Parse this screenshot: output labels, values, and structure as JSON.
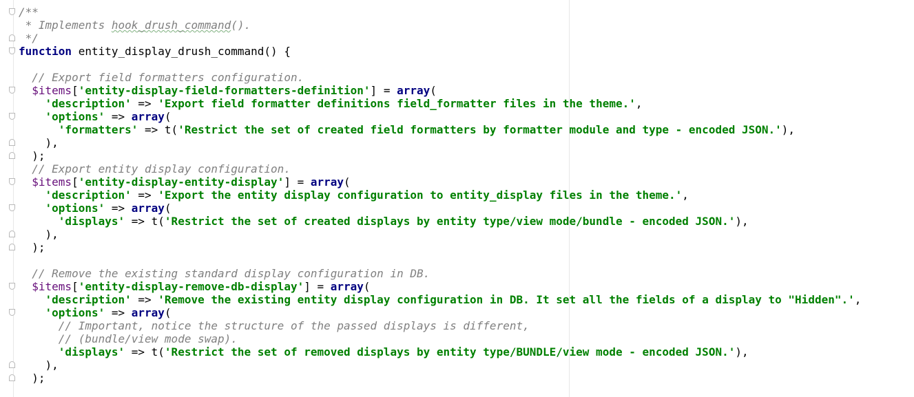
{
  "editor": {
    "language": "php",
    "lines": [
      {
        "fold": "open",
        "tokens": [
          {
            "c": "comment",
            "t": "/**"
          }
        ]
      },
      {
        "tokens": [
          {
            "c": "comment",
            "t": " * Implements "
          },
          {
            "c": "comment typo",
            "t": "hook_drush_command"
          },
          {
            "c": "comment",
            "t": "()."
          }
        ]
      },
      {
        "fold": "close",
        "tokens": [
          {
            "c": "comment",
            "t": " */"
          }
        ]
      },
      {
        "fold": "open",
        "tokens": [
          {
            "c": "kw",
            "t": "function"
          },
          {
            "c": "plain",
            "t": " entity_display_drush_command() {"
          }
        ]
      },
      {
        "tokens": []
      },
      {
        "tokens": [
          {
            "c": "comment",
            "t": "  // Export field formatters configuration."
          }
        ]
      },
      {
        "fold": "open",
        "tokens": [
          {
            "c": "var",
            "t": "  $items"
          },
          {
            "c": "plain",
            "t": "["
          },
          {
            "c": "str",
            "t": "'entity-display-field-formatters-definition'"
          },
          {
            "c": "plain",
            "t": "] = "
          },
          {
            "c": "kw",
            "t": "array"
          },
          {
            "c": "plain",
            "t": "("
          }
        ]
      },
      {
        "tokens": [
          {
            "c": "str",
            "t": "    'description'"
          },
          {
            "c": "plain",
            "t": " => "
          },
          {
            "c": "str",
            "t": "'Export field formatter definitions field_formatter files in the theme.'"
          },
          {
            "c": "plain",
            "t": ","
          }
        ]
      },
      {
        "fold": "open",
        "tokens": [
          {
            "c": "str",
            "t": "    'options'"
          },
          {
            "c": "plain",
            "t": " => "
          },
          {
            "c": "kw",
            "t": "array"
          },
          {
            "c": "plain",
            "t": "("
          }
        ]
      },
      {
        "tokens": [
          {
            "c": "str",
            "t": "      'formatters'"
          },
          {
            "c": "plain",
            "t": " => t("
          },
          {
            "c": "str",
            "t": "'Restrict the set of created field formatters by formatter module and type - encoded JSON.'"
          },
          {
            "c": "plain",
            "t": "),"
          }
        ]
      },
      {
        "fold": "close",
        "tokens": [
          {
            "c": "plain",
            "t": "    ),"
          }
        ]
      },
      {
        "fold": "close",
        "tokens": [
          {
            "c": "plain",
            "t": "  );"
          }
        ]
      },
      {
        "tokens": [
          {
            "c": "comment",
            "t": "  // Export entity display configuration."
          }
        ]
      },
      {
        "fold": "open",
        "tokens": [
          {
            "c": "var",
            "t": "  $items"
          },
          {
            "c": "plain",
            "t": "["
          },
          {
            "c": "str",
            "t": "'entity-display-entity-display'"
          },
          {
            "c": "plain",
            "t": "] = "
          },
          {
            "c": "kw",
            "t": "array"
          },
          {
            "c": "plain",
            "t": "("
          }
        ]
      },
      {
        "tokens": [
          {
            "c": "str",
            "t": "    'description'"
          },
          {
            "c": "plain",
            "t": " => "
          },
          {
            "c": "str",
            "t": "'Export the entity display configuration to entity_display files in the theme.'"
          },
          {
            "c": "plain",
            "t": ","
          }
        ]
      },
      {
        "fold": "open",
        "tokens": [
          {
            "c": "str",
            "t": "    'options'"
          },
          {
            "c": "plain",
            "t": " => "
          },
          {
            "c": "kw",
            "t": "array"
          },
          {
            "c": "plain",
            "t": "("
          }
        ]
      },
      {
        "tokens": [
          {
            "c": "str",
            "t": "      'displays'"
          },
          {
            "c": "plain",
            "t": " => t("
          },
          {
            "c": "str",
            "t": "'Restrict the set of created displays by entity type/view mode/bundle - encoded JSON.'"
          },
          {
            "c": "plain",
            "t": "),"
          }
        ]
      },
      {
        "fold": "close",
        "tokens": [
          {
            "c": "plain",
            "t": "    ),"
          }
        ]
      },
      {
        "fold": "close",
        "tokens": [
          {
            "c": "plain",
            "t": "  );"
          }
        ]
      },
      {
        "tokens": []
      },
      {
        "tokens": [
          {
            "c": "comment",
            "t": "  // Remove the existing standard display configuration in DB."
          }
        ]
      },
      {
        "fold": "open",
        "tokens": [
          {
            "c": "var",
            "t": "  $items"
          },
          {
            "c": "plain",
            "t": "["
          },
          {
            "c": "str",
            "t": "'entity-display-remove-db-display'"
          },
          {
            "c": "plain",
            "t": "] = "
          },
          {
            "c": "kw",
            "t": "array"
          },
          {
            "c": "plain",
            "t": "("
          }
        ]
      },
      {
        "tokens": [
          {
            "c": "str",
            "t": "    'description'"
          },
          {
            "c": "plain",
            "t": " => "
          },
          {
            "c": "str",
            "t": "'Remove the existing entity display configuration in DB. It set all the fields of a display to \"Hidden\".'"
          },
          {
            "c": "plain",
            "t": ","
          }
        ]
      },
      {
        "fold": "open",
        "tokens": [
          {
            "c": "str",
            "t": "    'options'"
          },
          {
            "c": "plain",
            "t": " => "
          },
          {
            "c": "kw",
            "t": "array"
          },
          {
            "c": "plain",
            "t": "("
          }
        ]
      },
      {
        "tokens": [
          {
            "c": "comment",
            "t": "      // Important, notice the structure of the passed displays is different,"
          }
        ]
      },
      {
        "tokens": [
          {
            "c": "comment",
            "t": "      // (bundle/view mode swap)."
          }
        ]
      },
      {
        "tokens": [
          {
            "c": "str",
            "t": "      'displays'"
          },
          {
            "c": "plain",
            "t": " => t("
          },
          {
            "c": "str",
            "t": "'Restrict the set of removed displays by entity type/BUNDLE/view mode - encoded JSON.'"
          },
          {
            "c": "plain",
            "t": "),"
          }
        ]
      },
      {
        "fold": "close",
        "tokens": [
          {
            "c": "plain",
            "t": "    ),"
          }
        ]
      },
      {
        "fold": "close",
        "tokens": [
          {
            "c": "plain",
            "t": "  );"
          }
        ]
      }
    ]
  }
}
